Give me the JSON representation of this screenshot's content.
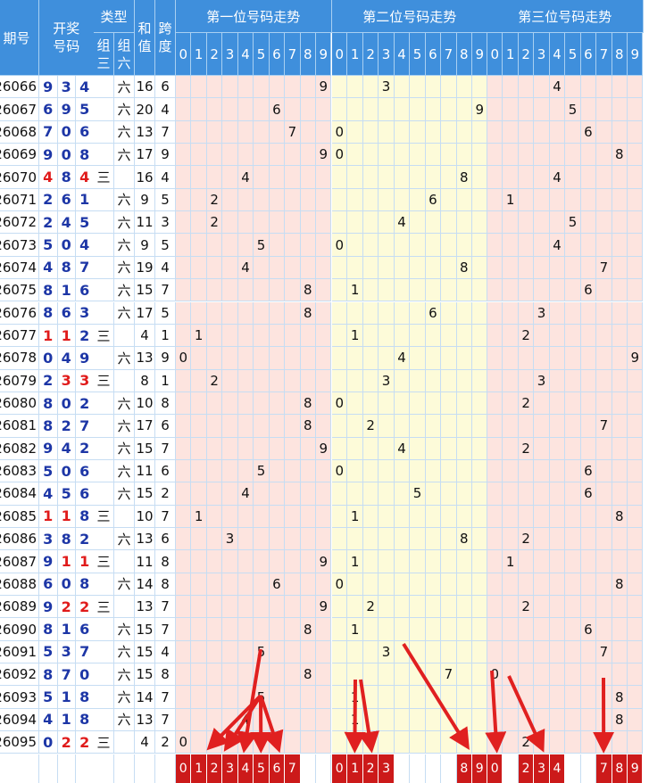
{
  "header": {
    "issue_label": "期号",
    "draw_label_top": "开奖",
    "draw_label_bottom": "号码",
    "type_label": "类型",
    "type_sub1_top": "组",
    "type_sub1_bottom": "三",
    "type_sub2_top": "组",
    "type_sub2_bottom": "六",
    "sum_top": "和",
    "sum_bottom": "值",
    "span_top": "跨",
    "span_bottom": "度",
    "group1_title": "第一位号码走势",
    "group2_title": "第二位号码走势",
    "group3_title": "第三位号码走势",
    "digits": [
      "0",
      "1",
      "2",
      "3",
      "4",
      "5",
      "6",
      "7",
      "8",
      "9"
    ]
  },
  "rows": [
    {
      "issue": "26066",
      "d": [
        "9",
        "3",
        "4"
      ],
      "z3": "",
      "z6": "六",
      "sum": "16",
      "span": "6"
    },
    {
      "issue": "26067",
      "d": [
        "6",
        "9",
        "5"
      ],
      "z3": "",
      "z6": "六",
      "sum": "20",
      "span": "4"
    },
    {
      "issue": "26068",
      "d": [
        "7",
        "0",
        "6"
      ],
      "z3": "",
      "z6": "六",
      "sum": "13",
      "span": "7"
    },
    {
      "issue": "26069",
      "d": [
        "9",
        "0",
        "8"
      ],
      "z3": "",
      "z6": "六",
      "sum": "17",
      "span": "9"
    },
    {
      "issue": "26070",
      "d": [
        "4",
        "8",
        "4"
      ],
      "z3": "三",
      "z6": "",
      "sum": "16",
      "span": "4"
    },
    {
      "issue": "26071",
      "d": [
        "2",
        "6",
        "1"
      ],
      "z3": "",
      "z6": "六",
      "sum": "9",
      "span": "5"
    },
    {
      "issue": "26072",
      "d": [
        "2",
        "4",
        "5"
      ],
      "z3": "",
      "z6": "六",
      "sum": "11",
      "span": "3"
    },
    {
      "issue": "26073",
      "d": [
        "5",
        "0",
        "4"
      ],
      "z3": "",
      "z6": "六",
      "sum": "9",
      "span": "5"
    },
    {
      "issue": "26074",
      "d": [
        "4",
        "8",
        "7"
      ],
      "z3": "",
      "z6": "六",
      "sum": "19",
      "span": "4"
    },
    {
      "issue": "26075",
      "d": [
        "8",
        "1",
        "6"
      ],
      "z3": "",
      "z6": "六",
      "sum": "15",
      "span": "7"
    },
    {
      "issue": "26076",
      "d": [
        "8",
        "6",
        "3"
      ],
      "z3": "",
      "z6": "六",
      "sum": "17",
      "span": "5"
    },
    {
      "issue": "26077",
      "d": [
        "1",
        "1",
        "2"
      ],
      "z3": "三",
      "z6": "",
      "sum": "4",
      "span": "1"
    },
    {
      "issue": "26078",
      "d": [
        "0",
        "4",
        "9"
      ],
      "z3": "",
      "z6": "六",
      "sum": "13",
      "span": "9"
    },
    {
      "issue": "26079",
      "d": [
        "2",
        "3",
        "3"
      ],
      "z3": "三",
      "z6": "",
      "sum": "8",
      "span": "1"
    },
    {
      "issue": "26080",
      "d": [
        "8",
        "0",
        "2"
      ],
      "z3": "",
      "z6": "六",
      "sum": "10",
      "span": "8"
    },
    {
      "issue": "26081",
      "d": [
        "8",
        "2",
        "7"
      ],
      "z3": "",
      "z6": "六",
      "sum": "17",
      "span": "6"
    },
    {
      "issue": "26082",
      "d": [
        "9",
        "4",
        "2"
      ],
      "z3": "",
      "z6": "六",
      "sum": "15",
      "span": "7"
    },
    {
      "issue": "26083",
      "d": [
        "5",
        "0",
        "6"
      ],
      "z3": "",
      "z6": "六",
      "sum": "11",
      "span": "6"
    },
    {
      "issue": "26084",
      "d": [
        "4",
        "5",
        "6"
      ],
      "z3": "",
      "z6": "六",
      "sum": "15",
      "span": "2"
    },
    {
      "issue": "26085",
      "d": [
        "1",
        "1",
        "8"
      ],
      "z3": "三",
      "z6": "",
      "sum": "10",
      "span": "7"
    },
    {
      "issue": "26086",
      "d": [
        "3",
        "8",
        "2"
      ],
      "z3": "",
      "z6": "六",
      "sum": "13",
      "span": "6"
    },
    {
      "issue": "26087",
      "d": [
        "9",
        "1",
        "1"
      ],
      "z3": "三",
      "z6": "",
      "sum": "11",
      "span": "8"
    },
    {
      "issue": "26088",
      "d": [
        "6",
        "0",
        "8"
      ],
      "z3": "",
      "z6": "六",
      "sum": "14",
      "span": "8"
    },
    {
      "issue": "26089",
      "d": [
        "9",
        "2",
        "2"
      ],
      "z3": "三",
      "z6": "",
      "sum": "13",
      "span": "7"
    },
    {
      "issue": "26090",
      "d": [
        "8",
        "1",
        "6"
      ],
      "z3": "",
      "z6": "六",
      "sum": "15",
      "span": "7"
    },
    {
      "issue": "26091",
      "d": [
        "5",
        "3",
        "7"
      ],
      "z3": "",
      "z6": "六",
      "sum": "15",
      "span": "4"
    },
    {
      "issue": "26092",
      "d": [
        "8",
        "7",
        "0"
      ],
      "z3": "",
      "z6": "六",
      "sum": "15",
      "span": "8"
    },
    {
      "issue": "26093",
      "d": [
        "5",
        "1",
        "8"
      ],
      "z3": "",
      "z6": "六",
      "sum": "14",
      "span": "7"
    },
    {
      "issue": "26094",
      "d": [
        "4",
        "1",
        "8"
      ],
      "z3": "",
      "z6": "六",
      "sum": "13",
      "span": "7"
    },
    {
      "issue": "26095",
      "d": [
        "0",
        "2",
        "2"
      ],
      "z3": "三",
      "z6": "",
      "sum": "4",
      "span": "2"
    }
  ],
  "predictions": {
    "pos1": [
      "0",
      "1",
      "2",
      "3",
      "4",
      "5",
      "6",
      "7"
    ],
    "pos2": [
      "0",
      "1",
      "2",
      "3",
      "8",
      "9"
    ],
    "pos3": [
      "0",
      "2",
      "3",
      "4",
      "7",
      "8",
      "9"
    ]
  },
  "colors": {
    "header_blue": "#3f8fdc",
    "number_blue": "#1d36a6",
    "number_red": "#e01b1b",
    "pos1_bg": "#fde4df",
    "pos2_bg": "#fdfbd9",
    "pos3_bg": "#fde4df",
    "prediction_red": "#cc1a1a",
    "arrow_red": "#e02020"
  }
}
